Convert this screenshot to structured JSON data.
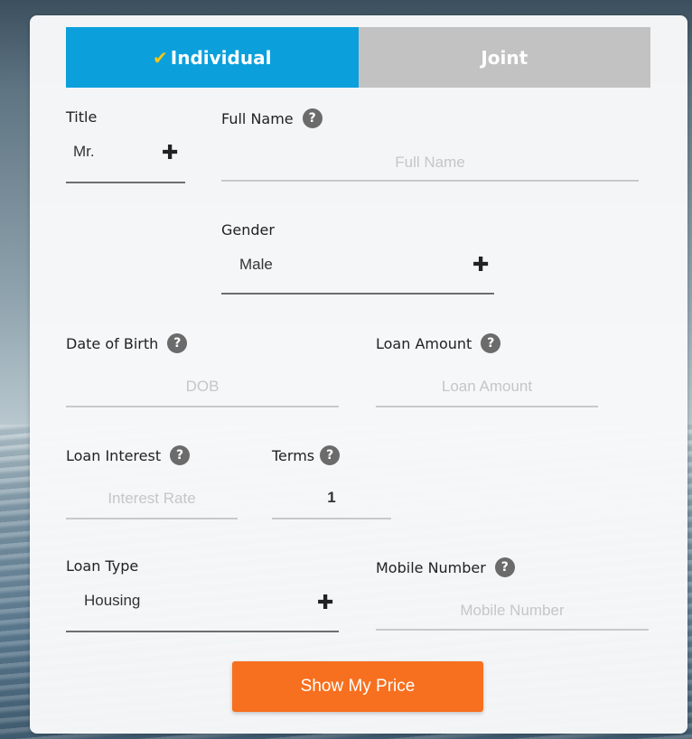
{
  "tabs": {
    "individual": "Individual",
    "joint": "Joint"
  },
  "form": {
    "title": {
      "label": "Title",
      "value": "Mr."
    },
    "full_name": {
      "label": "Full Name",
      "placeholder": "Full Name"
    },
    "gender": {
      "label": "Gender",
      "value": "Male"
    },
    "dob": {
      "label": "Date of Birth",
      "placeholder": "DOB"
    },
    "loan_amount": {
      "label": "Loan Amount",
      "placeholder": "Loan Amount"
    },
    "loan_interest": {
      "label": "Loan Interest",
      "placeholder": "Interest Rate"
    },
    "terms": {
      "label": "Terms",
      "value": "1"
    },
    "loan_type": {
      "label": "Loan Type",
      "value": "Housing"
    },
    "mobile": {
      "label": "Mobile Number",
      "placeholder": "Mobile Number"
    }
  },
  "help_symbol": "?",
  "plus_symbol": "✚",
  "check_symbol": "✔",
  "submit_label": "Show My Price",
  "colors": {
    "tab_active": "#0ba0dc",
    "tab_inactive": "#c3c2c2",
    "button": "#f7701f",
    "check": "#f2c619"
  }
}
